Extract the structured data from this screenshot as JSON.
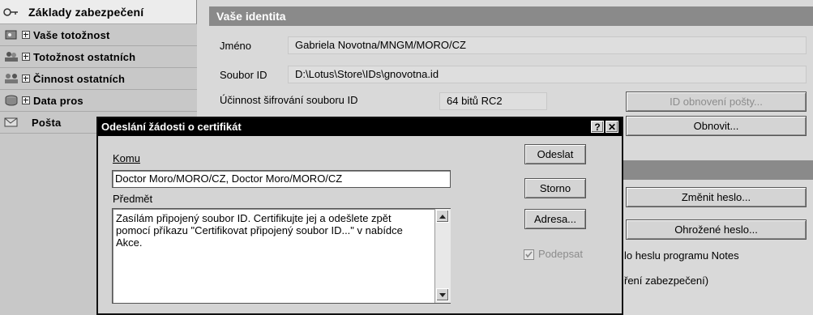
{
  "sidebar": {
    "items": [
      {
        "label": "Základy zabezpečení",
        "icon": "key-icon",
        "selected": true
      },
      {
        "label": "Vaše totožnost",
        "icon": "id-card-icon",
        "expand": "+"
      },
      {
        "label": "Totožnost ostatních",
        "icon": "people-icon",
        "expand": "+"
      },
      {
        "label": "Činnost ostatních",
        "icon": "group-icon",
        "expand": "+"
      },
      {
        "label": "Data pros",
        "icon": "database-icon",
        "expand": "+"
      },
      {
        "label": "Pošta",
        "icon": "mail-icon"
      }
    ]
  },
  "identity": {
    "section_title": "Vaše identita",
    "name_label": "Jméno",
    "name_value": "Gabriela Novotna/MNGM/MORO/CZ",
    "file_label": "Soubor ID",
    "file_value": "D:\\Lotus\\Store\\IDs\\gnovotna.id",
    "encryption_label": "Účinnost šifrování souboru ID",
    "encryption_value": "64 bitů RC2",
    "recovery_button": "ID obnovení pošty...",
    "refresh_button": "Obnovit...",
    "change_password_button": "Změnit heslo...",
    "compromised_password_button": "Ohrožené heslo...",
    "partial_text_1": "lo heslu programu Notes",
    "partial_text_2": "ření zabezpečení)"
  },
  "dialog": {
    "title": "Odeslání žádosti o certifikát",
    "help_label": "?",
    "close_label": "✕",
    "to_label": "Komu",
    "to_value": "Doctor Moro/MORO/CZ, Doctor Moro/MORO/CZ",
    "subject_label": "Předmět",
    "subject_value": "Zasílám připojený soubor ID. Certifikujte jej a odešlete zpět pomocí příkazu \"Certifikovat připojený soubor ID...\" v nabídce Akce.",
    "send_button": "Odeslat",
    "cancel_button": "Storno",
    "address_button": "Adresa...",
    "sign_label": "Podepsat",
    "sign_checked": true
  }
}
